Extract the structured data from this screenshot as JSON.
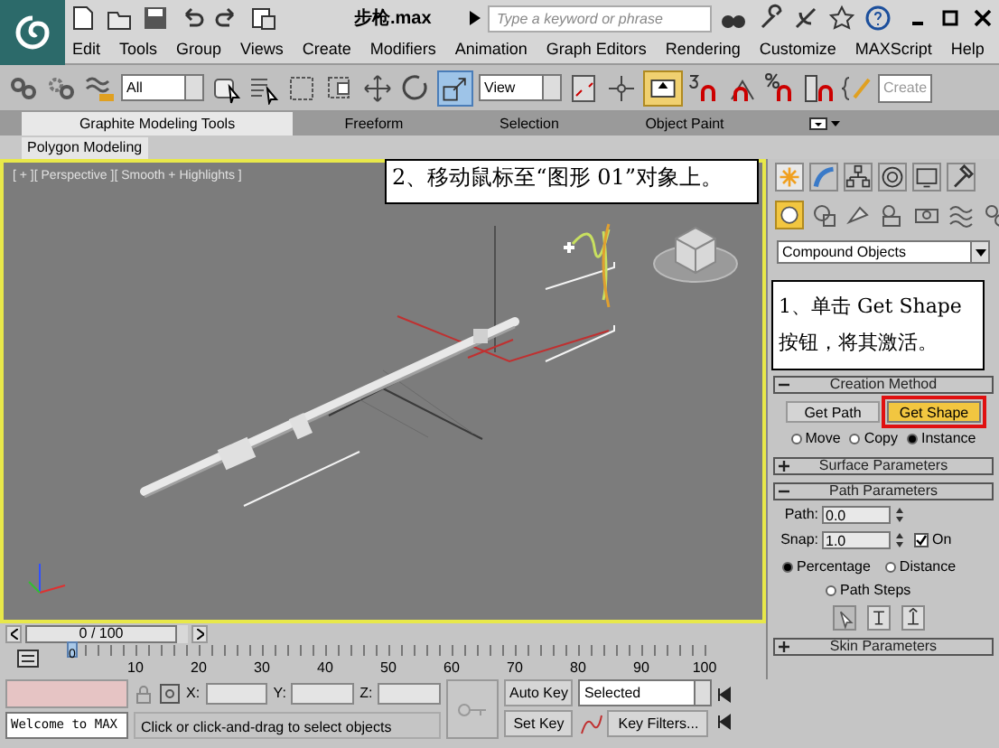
{
  "window": {
    "title": "步枪.max",
    "search_placeholder": "Type a keyword or phrase"
  },
  "menu": [
    "Edit",
    "Tools",
    "Group",
    "Views",
    "Create",
    "Modifiers",
    "Animation",
    "Graph Editors",
    "Rendering",
    "Customize",
    "MAXScript",
    "Help"
  ],
  "toolbar": {
    "selection_filter": "All",
    "reference_coord": "View",
    "named_selection_placeholder": "Create"
  },
  "ribbon": {
    "tabs": [
      {
        "label": "Graphite Modeling Tools",
        "selected": true
      },
      {
        "label": "Freeform",
        "selected": false
      },
      {
        "label": "Selection",
        "selected": false
      },
      {
        "label": "Object Paint",
        "selected": false
      }
    ],
    "panel": "Polygon Modeling"
  },
  "viewport": {
    "label": "[ + ][ Perspective ][ Smooth + Highlights ]",
    "active": true
  },
  "callouts": [
    {
      "text": "2、移动鼠标至“图形 01”对象上。"
    },
    {
      "text": "1、单击 Get Shape 按钮，将其激活。"
    }
  ],
  "command_panel": {
    "category": "Compound Objects",
    "creation_method": {
      "title": "Creation Method",
      "expanded": true,
      "buttons": [
        {
          "label": "Get Path",
          "active": false,
          "highlighted": false
        },
        {
          "label": "Get Shape",
          "active": true,
          "highlighted": true
        }
      ],
      "options": [
        {
          "label": "Move",
          "selected": false
        },
        {
          "label": "Copy",
          "selected": false
        },
        {
          "label": "Instance",
          "selected": true
        }
      ]
    },
    "surface_parameters": {
      "title": "Surface Parameters",
      "expanded": false
    },
    "path_parameters": {
      "title": "Path Parameters",
      "expanded": true,
      "fields": [
        {
          "label": "Path:",
          "value": "0.0"
        },
        {
          "label": "Snap:",
          "value": "1.0"
        }
      ],
      "snap_on": {
        "label": "On",
        "checked": true
      },
      "options": [
        {
          "label": "Percentage",
          "selected": true
        },
        {
          "label": "Distance",
          "selected": false
        },
        {
          "label": "Path Steps",
          "selected": false
        }
      ]
    },
    "skin_parameters": {
      "title": "Skin Parameters",
      "expanded": false
    }
  },
  "time_slider": {
    "label": "0 / 100",
    "level": 0
  },
  "track_bar": {
    "current_frame": "0",
    "labels": [
      "10",
      "20",
      "30",
      "40",
      "50",
      "60",
      "70",
      "80",
      "90",
      "100"
    ]
  },
  "status": {
    "listener": "Welcome to MAX",
    "prompt": "Click or click-and-drag to select objects",
    "coords": [
      "X:",
      "Y:",
      "Z:"
    ],
    "auto_key": "Auto Key",
    "set_key": "Set Key",
    "key_mode": "Selected",
    "key_filters": "Key Filters..."
  }
}
